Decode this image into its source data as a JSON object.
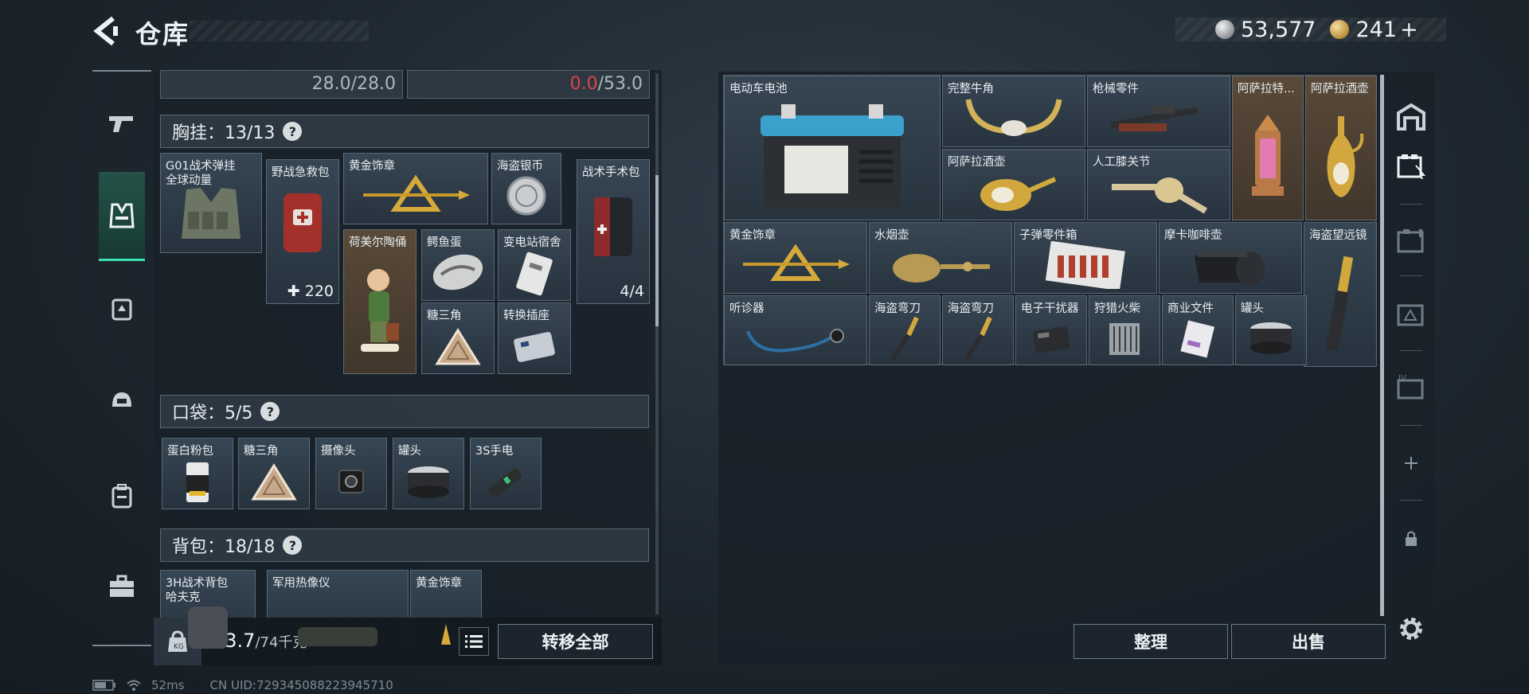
{
  "header": {
    "title": "仓库",
    "silver_amount": "53,577",
    "gold_amount": "241",
    "gold_plus": "+"
  },
  "left_panel": {
    "durability_a": "28.0/28.0",
    "durability_b_current": "0.0",
    "durability_b_max": "/53.0",
    "chest_rig": {
      "header": "胸挂：13/13",
      "rig_item": "G01战术弹挂",
      "rig_sub": "全球动量",
      "items": [
        {
          "label": "野战急救包",
          "value": "✚ 220"
        },
        {
          "label": "黄金饰章"
        },
        {
          "label": "海盗银币"
        },
        {
          "label": "战术手术包",
          "value": "4/4"
        },
        {
          "label": "荷美尔陶俑"
        },
        {
          "label": "鳄鱼蛋"
        },
        {
          "label": "变电站宿舍"
        },
        {
          "label": "糖三角"
        },
        {
          "label": "转换插座"
        }
      ]
    },
    "pocket": {
      "header": "口袋：5/5",
      "items": [
        {
          "label": "蛋白粉包"
        },
        {
          "label": "糖三角"
        },
        {
          "label": "摄像头"
        },
        {
          "label": "罐头"
        },
        {
          "label": "3S手电"
        }
      ]
    },
    "backpack": {
      "header": "背包：18/18",
      "bag_item": "3H战术背包",
      "bag_sub": "哈夫克",
      "items": [
        {
          "label": "军用热像仪"
        },
        {
          "label": "黄金饰章"
        }
      ]
    },
    "weight_current": "43.7",
    "weight_max": "/74千克",
    "transfer_all": "转移全部"
  },
  "warehouse": {
    "items": [
      {
        "label": "电动车电池"
      },
      {
        "label": "完整牛角"
      },
      {
        "label": "枪械零件"
      },
      {
        "label": "阿萨拉特..."
      },
      {
        "label": "阿萨拉酒壶"
      },
      {
        "label": "阿萨拉酒壶"
      },
      {
        "label": "人工膝关节"
      },
      {
        "label": "黄金饰章"
      },
      {
        "label": "水烟壶"
      },
      {
        "label": "子弹零件箱"
      },
      {
        "label": "摩卡咖啡壶"
      },
      {
        "label": "海盗望远镜"
      },
      {
        "label": "听诊器"
      },
      {
        "label": "海盗弯刀"
      },
      {
        "label": "海盗弯刀"
      },
      {
        "label": "电子干扰器"
      },
      {
        "label": "狩猎火柴"
      },
      {
        "label": "商业文件"
      },
      {
        "label": "罐头"
      }
    ],
    "sort_label": "整理",
    "sell_label": "出售"
  },
  "status": {
    "ping": "52ms",
    "uid": "CN UID:7293450882239457​10"
  },
  "colors": {
    "accent_teal": "#3ee0b0",
    "danger_red": "#e0424a",
    "panel_bg": "#18212a"
  }
}
